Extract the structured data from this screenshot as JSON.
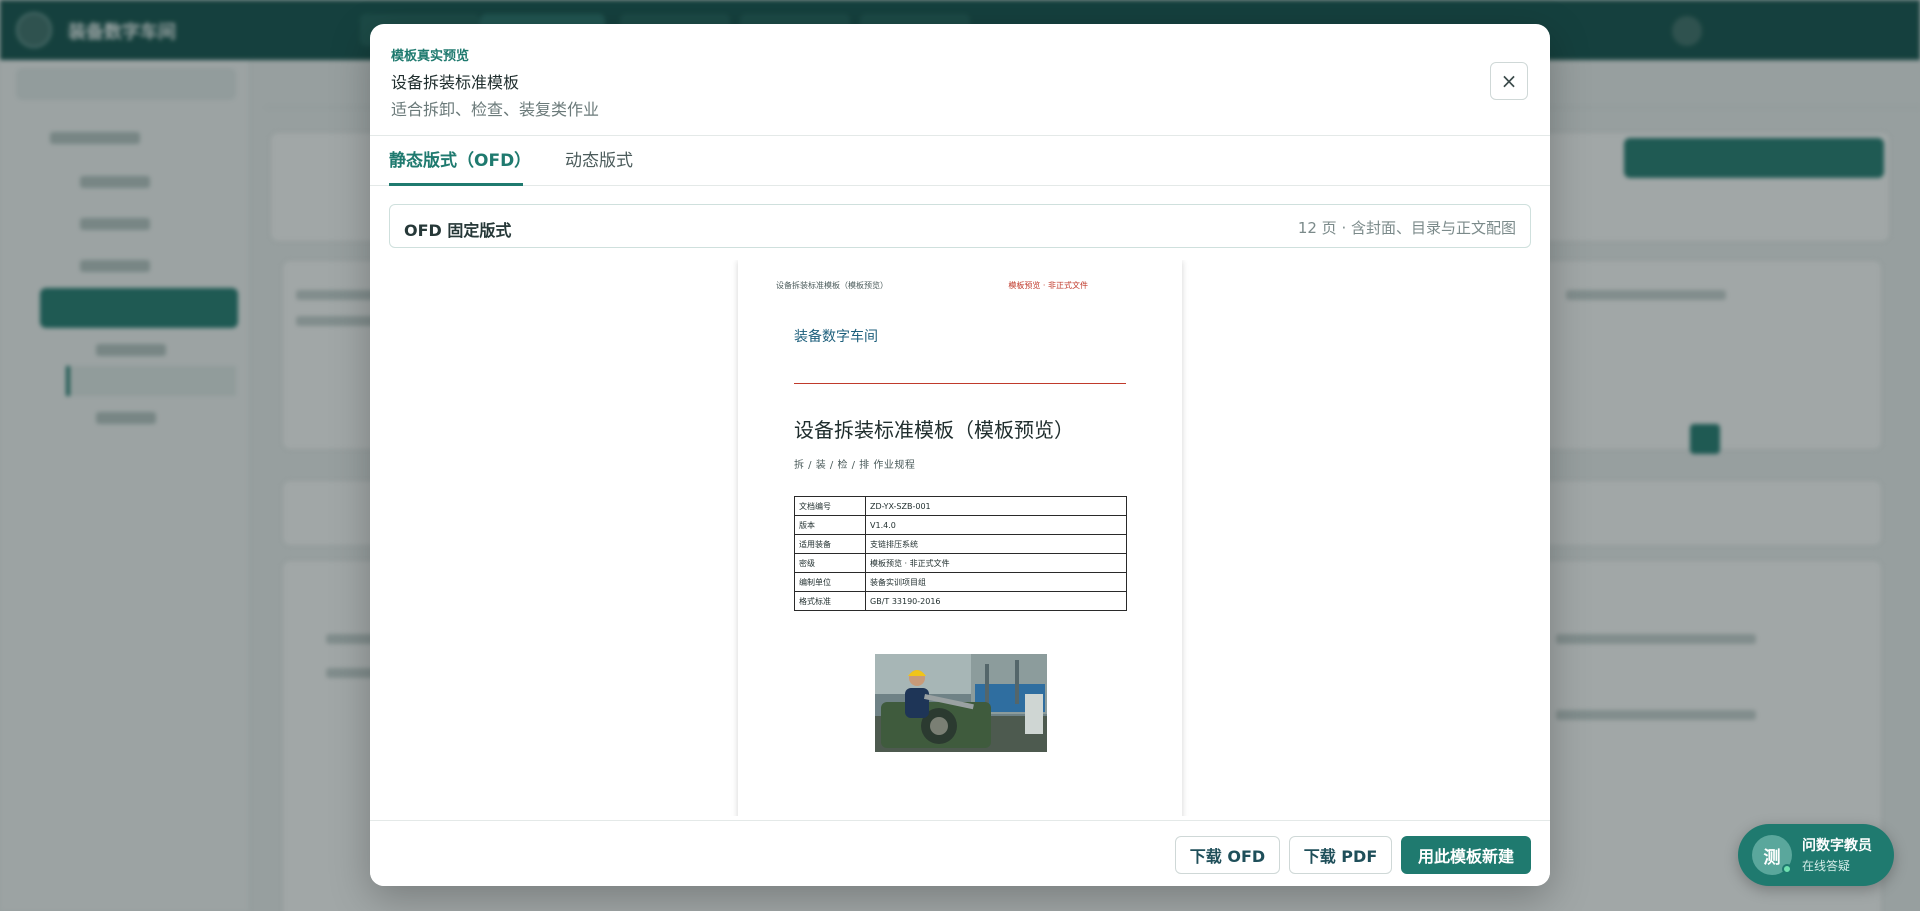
{
  "background": {
    "app_name": "装备数字车间"
  },
  "modal": {
    "kicker": "模板真实预览",
    "title": "设备拆装标准模板",
    "subtitle": "适合拆卸、检查、装复类作业",
    "close_icon": "×",
    "tabs": [
      {
        "label": "静态版式（OFD）",
        "active": true
      },
      {
        "label": "动态版式",
        "active": false
      }
    ],
    "ofd_bar": {
      "title": "OFD 固定版式",
      "meta": "12 页 · 含封面、目录与正文配图"
    },
    "page": {
      "header_left": "设备拆装标准模板（模板预览）",
      "header_right": "模板预览 · 非正式文件",
      "org": "装备数字车间",
      "title": "设备拆装标准模板（模板预览）",
      "subtitle": "拆 / 装 / 检 / 排 作业规程",
      "table": [
        {
          "key": "文档编号",
          "value": "ZD-YX-SZB-001"
        },
        {
          "key": "版本",
          "value": "V1.4.0"
        },
        {
          "key": "适用装备",
          "value": "支链排压系统"
        },
        {
          "key": "密级",
          "value": "模板预览 · 非正式文件"
        },
        {
          "key": "编制单位",
          "value": "装备实训项目组"
        },
        {
          "key": "格式标准",
          "value": "GB/T 33190-2016"
        }
      ]
    },
    "footer": {
      "download_ofd": "下载 OFD",
      "download_pdf": "下载 PDF",
      "create_from_template": "用此模板新建"
    }
  },
  "assistant": {
    "avatar_text": "测",
    "name": "问数字教员",
    "status": "在线答疑"
  },
  "colors": {
    "brand": "#1f7a6f",
    "topbar": "#0f4f4a",
    "accent_red": "#c03a2b"
  }
}
